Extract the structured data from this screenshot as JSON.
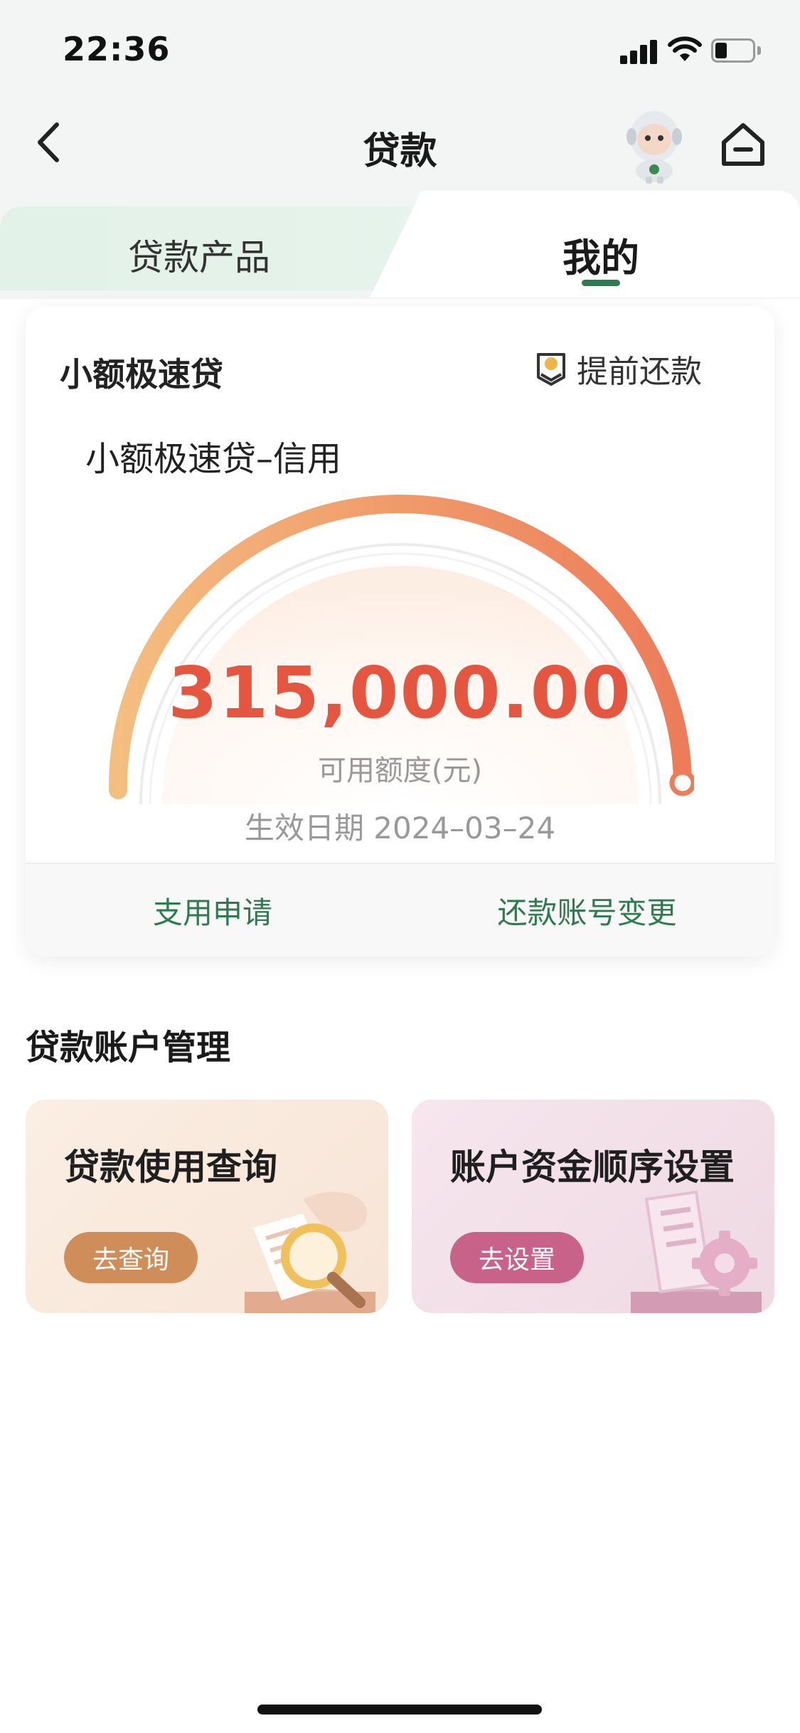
{
  "status_bar": {
    "time": "22:36"
  },
  "nav": {
    "title": "贷款"
  },
  "tabs": [
    {
      "label": "贷款产品",
      "active": false
    },
    {
      "label": "我的",
      "active": true
    }
  ],
  "loan_card": {
    "title": "小额极速贷",
    "prepay_label": "提前还款",
    "product_name": "小额极速贷–信用",
    "amount": "315,000.00",
    "amount_label": "可用额度(元)",
    "effective_date": "生效日期 2024–03–24",
    "actions": {
      "apply": "支用申请",
      "change_account": "还款账号变更"
    }
  },
  "management": {
    "title": "贷款账户管理",
    "tiles": [
      {
        "title": "贷款使用查询",
        "button": "去查询"
      },
      {
        "title": "账户资金顺序设置",
        "button": "去设置"
      }
    ]
  },
  "colors": {
    "brand_green": "#2f7a4e",
    "amount_red": "#e4563f",
    "gauge_start": "#f3b97a",
    "gauge_end": "#ee7f5a",
    "query_button": "#cf8d59",
    "settings_button": "#c96289"
  },
  "icons": [
    "back-icon",
    "mascot-icon",
    "home-icon",
    "prepay-icon",
    "magnifier-document-icon",
    "phone-gear-icon"
  ]
}
